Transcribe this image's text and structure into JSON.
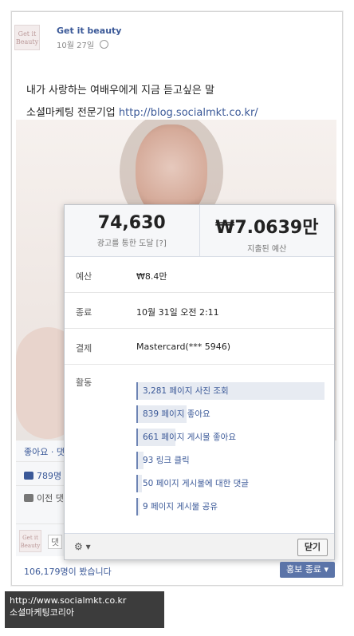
{
  "post": {
    "page_name": "Get it beauty",
    "date": "10월 27일",
    "text": "내가 사랑하는 여배우에게 지금 듣고싶은 말",
    "line2_text": "소셜마케팅 전문기업 ",
    "link": "http://blog.socialmkt.co.kr/"
  },
  "left_bottom": {
    "like_label": "좋아요 · 댓",
    "likes_count": "789명",
    "previous_label": "이전 댓",
    "comment_placeholder": "댓"
  },
  "overlay": {
    "reach_value": "74,630",
    "reach_label": "광고를 통한 도달 [?]",
    "spend_value": "₩7.0639만",
    "spend_label": "지출된 예산",
    "rows": [
      {
        "key": "예산",
        "value": "₩8.4만"
      },
      {
        "key": "종료",
        "value": "10월 31일 오전 2:11"
      },
      {
        "key": "결제",
        "value": "Mastercard(*** 5946)"
      }
    ],
    "activity_label": "활동",
    "activities": [
      {
        "text": "3,281 페이지 사진 조회",
        "fraction": 1.0
      },
      {
        "text": "839 페이지 좋아요",
        "fraction": 0.26
      },
      {
        "text": "661 페이지 게시물 좋아요",
        "fraction": 0.2
      },
      {
        "text": "93 링크 클릭",
        "fraction": 0.03
      },
      {
        "text": "50 페이지 게시물에 대한 댓글",
        "fraction": 0.02
      },
      {
        "text": "9 페이지 게시물 공유",
        "fraction": 0.01
      }
    ],
    "close_label": "닫기"
  },
  "promo": {
    "seen_text": "106,179명이 봤습니다",
    "button_label": "홍보 종료"
  },
  "watermark": {
    "url": "http://www.socialmkt.co.kr",
    "name": "소셜마케팅코리아"
  },
  "colors": {
    "brand_blue": "#3b5998",
    "button_blue": "#5b74a8"
  }
}
